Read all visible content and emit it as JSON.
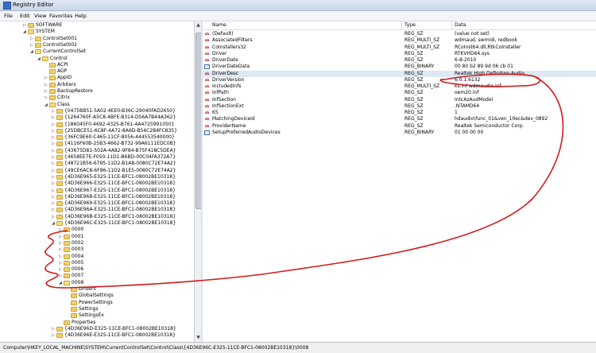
{
  "window": {
    "title": "Registry Editor"
  },
  "menu": [
    "File",
    "Edit",
    "View",
    "Favorites",
    "Help"
  ],
  "tree": [
    {
      "label": "SOFTWARE",
      "indent": 0,
      "arrow": "▷"
    },
    {
      "label": "SYSTEM",
      "indent": 0,
      "arrow": "◢",
      "open": true
    },
    {
      "label": "ControlSet001",
      "indent": 1,
      "arrow": "▷"
    },
    {
      "label": "ControlSet002",
      "indent": 1,
      "arrow": "▷"
    },
    {
      "label": "CurrentControlSet",
      "indent": 1,
      "arrow": "◢",
      "open": true
    },
    {
      "label": "Control",
      "indent": 2,
      "arrow": "◢",
      "open": true
    },
    {
      "label": "ACPI",
      "indent": 3,
      "arrow": ""
    },
    {
      "label": "AGP",
      "indent": 3,
      "arrow": ""
    },
    {
      "label": "AppID",
      "indent": 3,
      "arrow": "▷"
    },
    {
      "label": "Arbiters",
      "indent": 3,
      "arrow": "▷"
    },
    {
      "label": "BackupRestore",
      "indent": 3,
      "arrow": "▷"
    },
    {
      "label": "Citrix",
      "indent": 3,
      "arrow": "▷"
    },
    {
      "label": "Class",
      "indent": 3,
      "arrow": "◢",
      "open": true
    },
    {
      "label": "{0475BB51-5A02-4EE0-B36C-29040FAD2650}",
      "indent": 4,
      "arrow": "▷"
    },
    {
      "label": "{1264760F-A5C8-4BFE-B314-D56A7B44A362}",
      "indent": 4,
      "arrow": "▷"
    },
    {
      "label": "{186045F0-4692-4325-B761-4A4725991050}",
      "indent": 4,
      "arrow": "▷"
    },
    {
      "label": "{25DBCE51-6C8F-4A72-8A6D-B54C2B4FC835}",
      "indent": 4,
      "arrow": "▷"
    },
    {
      "label": "{36FC9E60-C465-11CF-8056-444553540000}",
      "indent": 4,
      "arrow": "▷"
    },
    {
      "label": "{4116F60B-25B3-4662-B732-99A6111EDC0B}",
      "indent": 4,
      "arrow": "▷"
    },
    {
      "label": "{43675D81-502A-4A82-9F84-B75F418C5DEA}",
      "indent": 4,
      "arrow": "▷"
    },
    {
      "label": "{4658EE7E-F050-11D1-B6BD-00C04FA372A7}",
      "indent": 4,
      "arrow": "▷"
    },
    {
      "label": "{48721B56-6795-11D2-B1A8-0080C72E74A2}",
      "indent": 4,
      "arrow": "▷"
    },
    {
      "label": "{49CE6AC8-6F86-11D2-B1E5-0080C72E74A2}",
      "indent": 4,
      "arrow": "▷"
    },
    {
      "label": "{4D36E965-E325-11CE-BFC1-08002BE10318}",
      "indent": 4,
      "arrow": "▷"
    },
    {
      "label": "{4D36E966-E325-11CE-BFC1-08002BE10318}",
      "indent": 4,
      "arrow": "▷"
    },
    {
      "label": "{4D36E967-E325-11CE-BFC1-08002BE10318}",
      "indent": 4,
      "arrow": "▷"
    },
    {
      "label": "{4D36E968-E325-11CE-BFC1-08002BE10318}",
      "indent": 4,
      "arrow": "▷"
    },
    {
      "label": "{4D36E969-E325-11CE-BFC1-08002BE10318}",
      "indent": 4,
      "arrow": "▷"
    },
    {
      "label": "{4D36E96A-E325-11CE-BFC1-08002BE10318}",
      "indent": 4,
      "arrow": "▷"
    },
    {
      "label": "{4D36E96B-E325-11CE-BFC1-08002BE10318}",
      "indent": 4,
      "arrow": "▷"
    },
    {
      "label": "{4D36E96C-E325-11CE-BFC1-08002BE10318}",
      "indent": 4,
      "arrow": "◢",
      "open": true
    },
    {
      "label": "0000",
      "indent": 5,
      "arrow": "▷"
    },
    {
      "label": "0001",
      "indent": 5,
      "arrow": "▷"
    },
    {
      "label": "0002",
      "indent": 5,
      "arrow": "▷"
    },
    {
      "label": "0003",
      "indent": 5,
      "arrow": "▷"
    },
    {
      "label": "0004",
      "indent": 5,
      "arrow": "▷"
    },
    {
      "label": "0005",
      "indent": 5,
      "arrow": "▷"
    },
    {
      "label": "0006",
      "indent": 5,
      "arrow": "▷"
    },
    {
      "label": "0007",
      "indent": 5,
      "arrow": "▷"
    },
    {
      "label": "0008",
      "indent": 5,
      "arrow": "◢",
      "open": true
    },
    {
      "label": "Drivers",
      "indent": 6,
      "arrow": ""
    },
    {
      "label": "GlobalSettings",
      "indent": 6,
      "arrow": ""
    },
    {
      "label": "PowerSettings",
      "indent": 6,
      "arrow": ""
    },
    {
      "label": "Settings",
      "indent": 6,
      "arrow": ""
    },
    {
      "label": "SettingsEx",
      "indent": 6,
      "arrow": ""
    },
    {
      "label": "Properties",
      "indent": 5,
      "arrow": ""
    },
    {
      "label": "{4D36E96D-E325-11CE-BFC1-08002BE10318}",
      "indent": 4,
      "arrow": "▷"
    },
    {
      "label": "{4D36E96E-E325-11CE-BFC1-08002BE10318}",
      "indent": 4,
      "arrow": "▷"
    }
  ],
  "columns": {
    "name": "Name",
    "type": "Type",
    "data": "Data"
  },
  "values": [
    {
      "name": "(Default)",
      "type": "REG_SZ",
      "data": "(value not set)",
      "icon": "sz"
    },
    {
      "name": "AssociatedFilters",
      "type": "REG_MULTI_SZ",
      "data": "wdmaud, swmidi, redbook",
      "icon": "sz"
    },
    {
      "name": "CoInstallers32",
      "type": "REG_MULTI_SZ",
      "data": "RCoInst64.dll,RtkCoInstaller",
      "icon": "sz"
    },
    {
      "name": "Driver",
      "type": "REG_SZ",
      "data": "RTKVHD64.sys",
      "icon": "sz"
    },
    {
      "name": "DriverDate",
      "type": "REG_SZ",
      "data": "6-8-2010",
      "icon": "sz"
    },
    {
      "name": "DriverDateData",
      "type": "REG_BINARY",
      "data": "00 80 b2 89 9d 06 cb 01",
      "icon": "bin"
    },
    {
      "name": "DriverDesc",
      "type": "REG_SZ",
      "data": "Realtek High Definition Audio",
      "icon": "sz",
      "highlight": true
    },
    {
      "name": "DriverVersion",
      "type": "REG_SZ",
      "data": "6.0.1.6132",
      "icon": "sz"
    },
    {
      "name": "IncludedInfs",
      "type": "REG_MULTI_SZ",
      "data": "ks.inf wdmaudio.inf",
      "icon": "sz"
    },
    {
      "name": "InfPath",
      "type": "REG_SZ",
      "data": "oem20.inf",
      "icon": "sz"
    },
    {
      "name": "InfSection",
      "type": "REG_SZ",
      "data": "IntcAzAudModel",
      "icon": "sz"
    },
    {
      "name": "InfSectionExt",
      "type": "REG_SZ",
      "data": ".NTAMD64",
      "icon": "sz"
    },
    {
      "name": "KS",
      "type": "REG_SZ",
      "data": "1",
      "icon": "sz"
    },
    {
      "name": "MatchingDeviceId",
      "type": "REG_SZ",
      "data": "hdaudio\\func_01&ven_10ec&dev_0892",
      "icon": "sz"
    },
    {
      "name": "ProviderName",
      "type": "REG_SZ",
      "data": "Realtek Semiconductor Corp.",
      "icon": "sz"
    },
    {
      "name": "SetupPreferredAudioDevices",
      "type": "REG_BINARY",
      "data": "01 00 00 00",
      "icon": "bin"
    }
  ],
  "status": {
    "path": "Computer\\HKEY_LOCAL_MACHINE\\SYSTEM\\CurrentControlSet\\Control\\Class\\{4D36E96C-E325-11CE-BFC1-08002BE10318}\\0008"
  },
  "colors": {
    "annotation": "#d11a1a",
    "folder": "#f1cf6a",
    "selection": "#dde8f5"
  }
}
